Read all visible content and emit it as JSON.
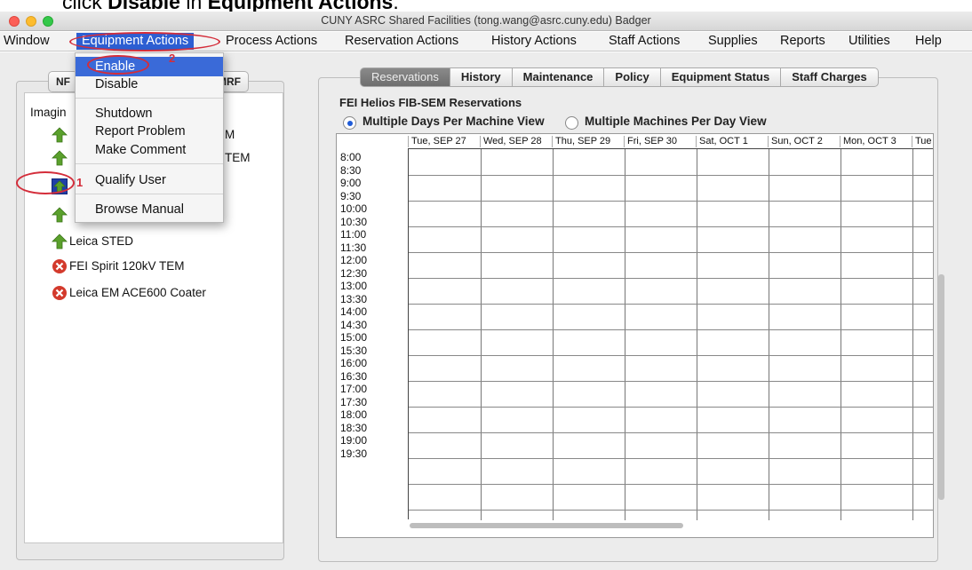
{
  "instruction": {
    "prefix": "click ",
    "target": "Disable",
    "middle": " in ",
    "menu": "Equipment Actions",
    "suffix": "."
  },
  "window": {
    "title": "CUNY ASRC Shared Facilities (tong.wang@asrc.cuny.edu) Badger"
  },
  "menubar": [
    "Window",
    "Equipment Actions",
    "Process Actions",
    "Reservation Actions",
    "History Actions",
    "Staff Actions",
    "Supplies",
    "Reports",
    "Utilities",
    "Help"
  ],
  "dropdown": {
    "items": [
      "Enable",
      "Disable",
      "Shutdown",
      "Report Problem",
      "Make Comment",
      "Qualify User",
      "Browse Manual"
    ],
    "highlighted": "Enable"
  },
  "left": {
    "tabs": [
      "NF",
      "MRF"
    ],
    "group": "Imagin",
    "partial_labels": [
      "M",
      "TEM"
    ],
    "tree_items": [
      {
        "label": "Leica STED",
        "status": "up"
      },
      {
        "label": "FEI Spirit 120kV TEM",
        "status": "down"
      },
      {
        "label": "Leica EM ACE600 Coater",
        "status": "down"
      }
    ]
  },
  "tabs": [
    "Reservations",
    "History",
    "Maintenance",
    "Policy",
    "Equipment Status",
    "Staff Charges"
  ],
  "selected_tab": "Reservations",
  "reservations": {
    "title": "FEI Helios FIB-SEM Reservations",
    "view_options": [
      "Multiple Days Per Machine View",
      "Multiple Machines Per Day View"
    ],
    "selected_view": "Multiple Days Per Machine View",
    "days": [
      "Tue, SEP 27",
      "Wed, SEP 28",
      "Thu, SEP 29",
      "Fri, SEP 30",
      "Sat, OCT 1",
      "Sun, OCT 2",
      "Mon, OCT 3",
      "Tue"
    ],
    "times": [
      "8:00",
      "8:30",
      "9:00",
      "9:30",
      "10:00",
      "10:30",
      "11:00",
      "11:30",
      "12:00",
      "12:30",
      "13:00",
      "13:30",
      "14:00",
      "14:30",
      "15:00",
      "15:30",
      "16:00",
      "16:30",
      "17:00",
      "17:30",
      "18:00",
      "18:30",
      "19:00",
      "19:30"
    ]
  },
  "annotations": [
    "1",
    "2"
  ],
  "colors": {
    "accent": "#3a6ad8",
    "annotation": "#d42d3a",
    "up_icon": "#5aa02c",
    "down_icon": "#d33a2c"
  }
}
